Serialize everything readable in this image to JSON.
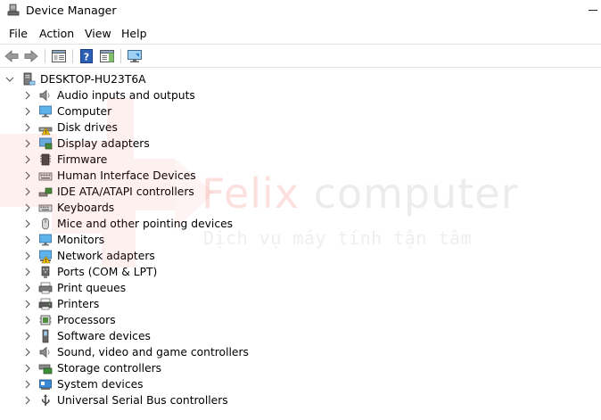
{
  "window": {
    "title": "Device Manager"
  },
  "menu": {
    "items": [
      "File",
      "Action",
      "View",
      "Help"
    ]
  },
  "toolbar": {
    "buttons": [
      "back-arrow-icon",
      "forward-arrow-icon",
      "properties-icon",
      "help-icon",
      "action-pane-icon",
      "monitor-scan-icon"
    ]
  },
  "tree": {
    "root": {
      "label": "DESKTOP-HU23T6A",
      "icon": "computer-tower-icon",
      "expanded": true
    },
    "categories": [
      {
        "label": "Audio inputs and outputs",
        "icon": "speaker-icon",
        "warning": false
      },
      {
        "label": "Computer",
        "icon": "monitor-icon",
        "warning": false
      },
      {
        "label": "Disk drives",
        "icon": "disk-drive-icon",
        "warning": true
      },
      {
        "label": "Display adapters",
        "icon": "display-adapter-icon",
        "warning": false
      },
      {
        "label": "Firmware",
        "icon": "chip-icon",
        "warning": false
      },
      {
        "label": "Human Interface Devices",
        "icon": "hid-icon",
        "warning": false
      },
      {
        "label": "IDE ATA/ATAPI controllers",
        "icon": "ide-controller-icon",
        "warning": false
      },
      {
        "label": "Keyboards",
        "icon": "keyboard-icon",
        "warning": false
      },
      {
        "label": "Mice and other pointing devices",
        "icon": "mouse-icon",
        "warning": false
      },
      {
        "label": "Monitors",
        "icon": "monitor-icon",
        "warning": false
      },
      {
        "label": "Network adapters",
        "icon": "network-adapter-icon",
        "warning": true
      },
      {
        "label": "Ports (COM & LPT)",
        "icon": "port-icon",
        "warning": false
      },
      {
        "label": "Print queues",
        "icon": "print-queue-icon",
        "warning": false
      },
      {
        "label": "Printers",
        "icon": "printer-icon",
        "warning": false
      },
      {
        "label": "Processors",
        "icon": "processor-icon",
        "warning": false
      },
      {
        "label": "Software devices",
        "icon": "software-device-icon",
        "warning": false
      },
      {
        "label": "Sound, video and game controllers",
        "icon": "speaker-icon",
        "warning": false
      },
      {
        "label": "Storage controllers",
        "icon": "storage-controller-icon",
        "warning": false
      },
      {
        "label": "System devices",
        "icon": "system-device-icon",
        "warning": false
      },
      {
        "label": "Universal Serial Bus controllers",
        "icon": "usb-icon",
        "warning": false
      }
    ]
  },
  "watermark": {
    "brand_part1": "Felix",
    "brand_part2": " computer",
    "tagline": "Dịch vụ máy tính tận tâm"
  },
  "colors": {
    "accent_blue": "#1e7fd3",
    "warning_yellow": "#f2c200",
    "brand_red": "#e53e30"
  }
}
